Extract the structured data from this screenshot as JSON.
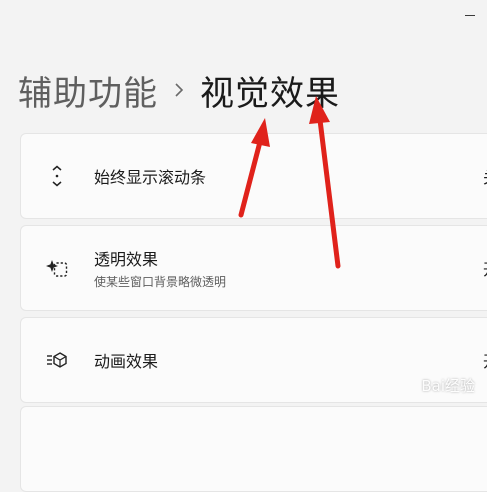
{
  "window": {
    "minimize_icon": "minimize-icon"
  },
  "breadcrumb": {
    "parent": "辅助功能",
    "separator_icon": "chevron-right-icon",
    "current": "视觉效果"
  },
  "settings": [
    {
      "icon": "scrollbar-arrows-icon",
      "title": "始终显示滚动条",
      "description": "",
      "value": "关"
    },
    {
      "icon": "transparency-sparkle-icon",
      "title": "透明效果",
      "description": "使某些窗口背景略微透明",
      "value": "开"
    },
    {
      "icon": "animation-icon",
      "title": "动画效果",
      "description": "",
      "value": "开"
    }
  ],
  "annotations": {
    "arrow_color": "#e0221b",
    "arrow_count": 2
  },
  "watermark": "Bai经验"
}
